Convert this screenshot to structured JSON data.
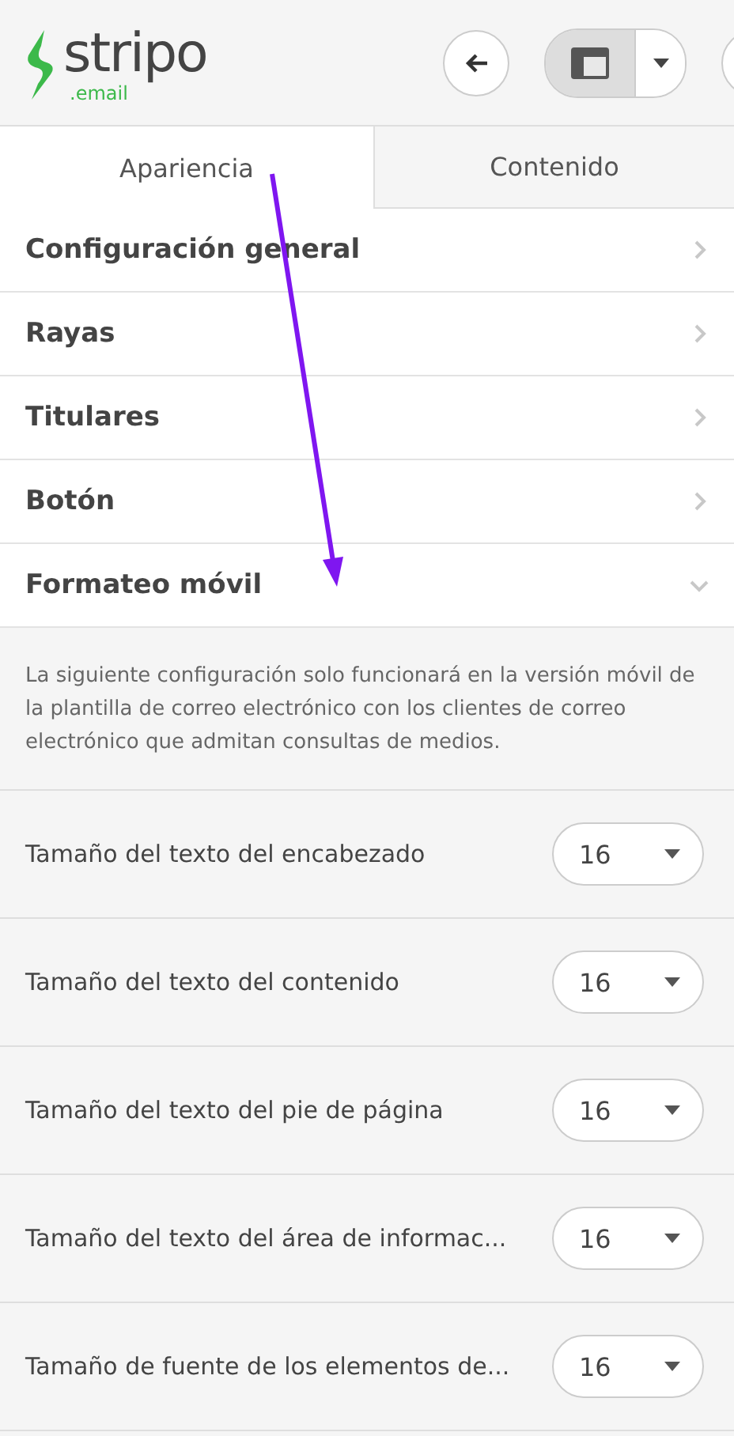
{
  "logo": {
    "name": "stripo",
    "suffix": ".email"
  },
  "tabs": [
    {
      "label": "Apariencia",
      "selected": true
    },
    {
      "label": "Contenido",
      "selected": false
    }
  ],
  "sections": [
    {
      "title": "Configuración general",
      "expanded": false
    },
    {
      "title": "Rayas",
      "expanded": false
    },
    {
      "title": "Titulares",
      "expanded": false
    },
    {
      "title": "Botón",
      "expanded": false
    },
    {
      "title": "Formateo móvil",
      "expanded": true
    }
  ],
  "note": "La siguiente configuración solo funcionará en la versión móvil de la plantilla de correo electrónico con los clientes de correo electrónico que admitan consultas de medios.",
  "settings": [
    {
      "label": "Tamaño del texto del encabezado",
      "value": "16"
    },
    {
      "label": "Tamaño del texto del contenido",
      "value": "16"
    },
    {
      "label": "Tamaño del texto del pie de página",
      "value": "16"
    },
    {
      "label": "Tamaño del texto del área de informac...",
      "value": "16"
    },
    {
      "label": "Tamaño de fuente de los elementos de...",
      "value": "16"
    }
  ]
}
